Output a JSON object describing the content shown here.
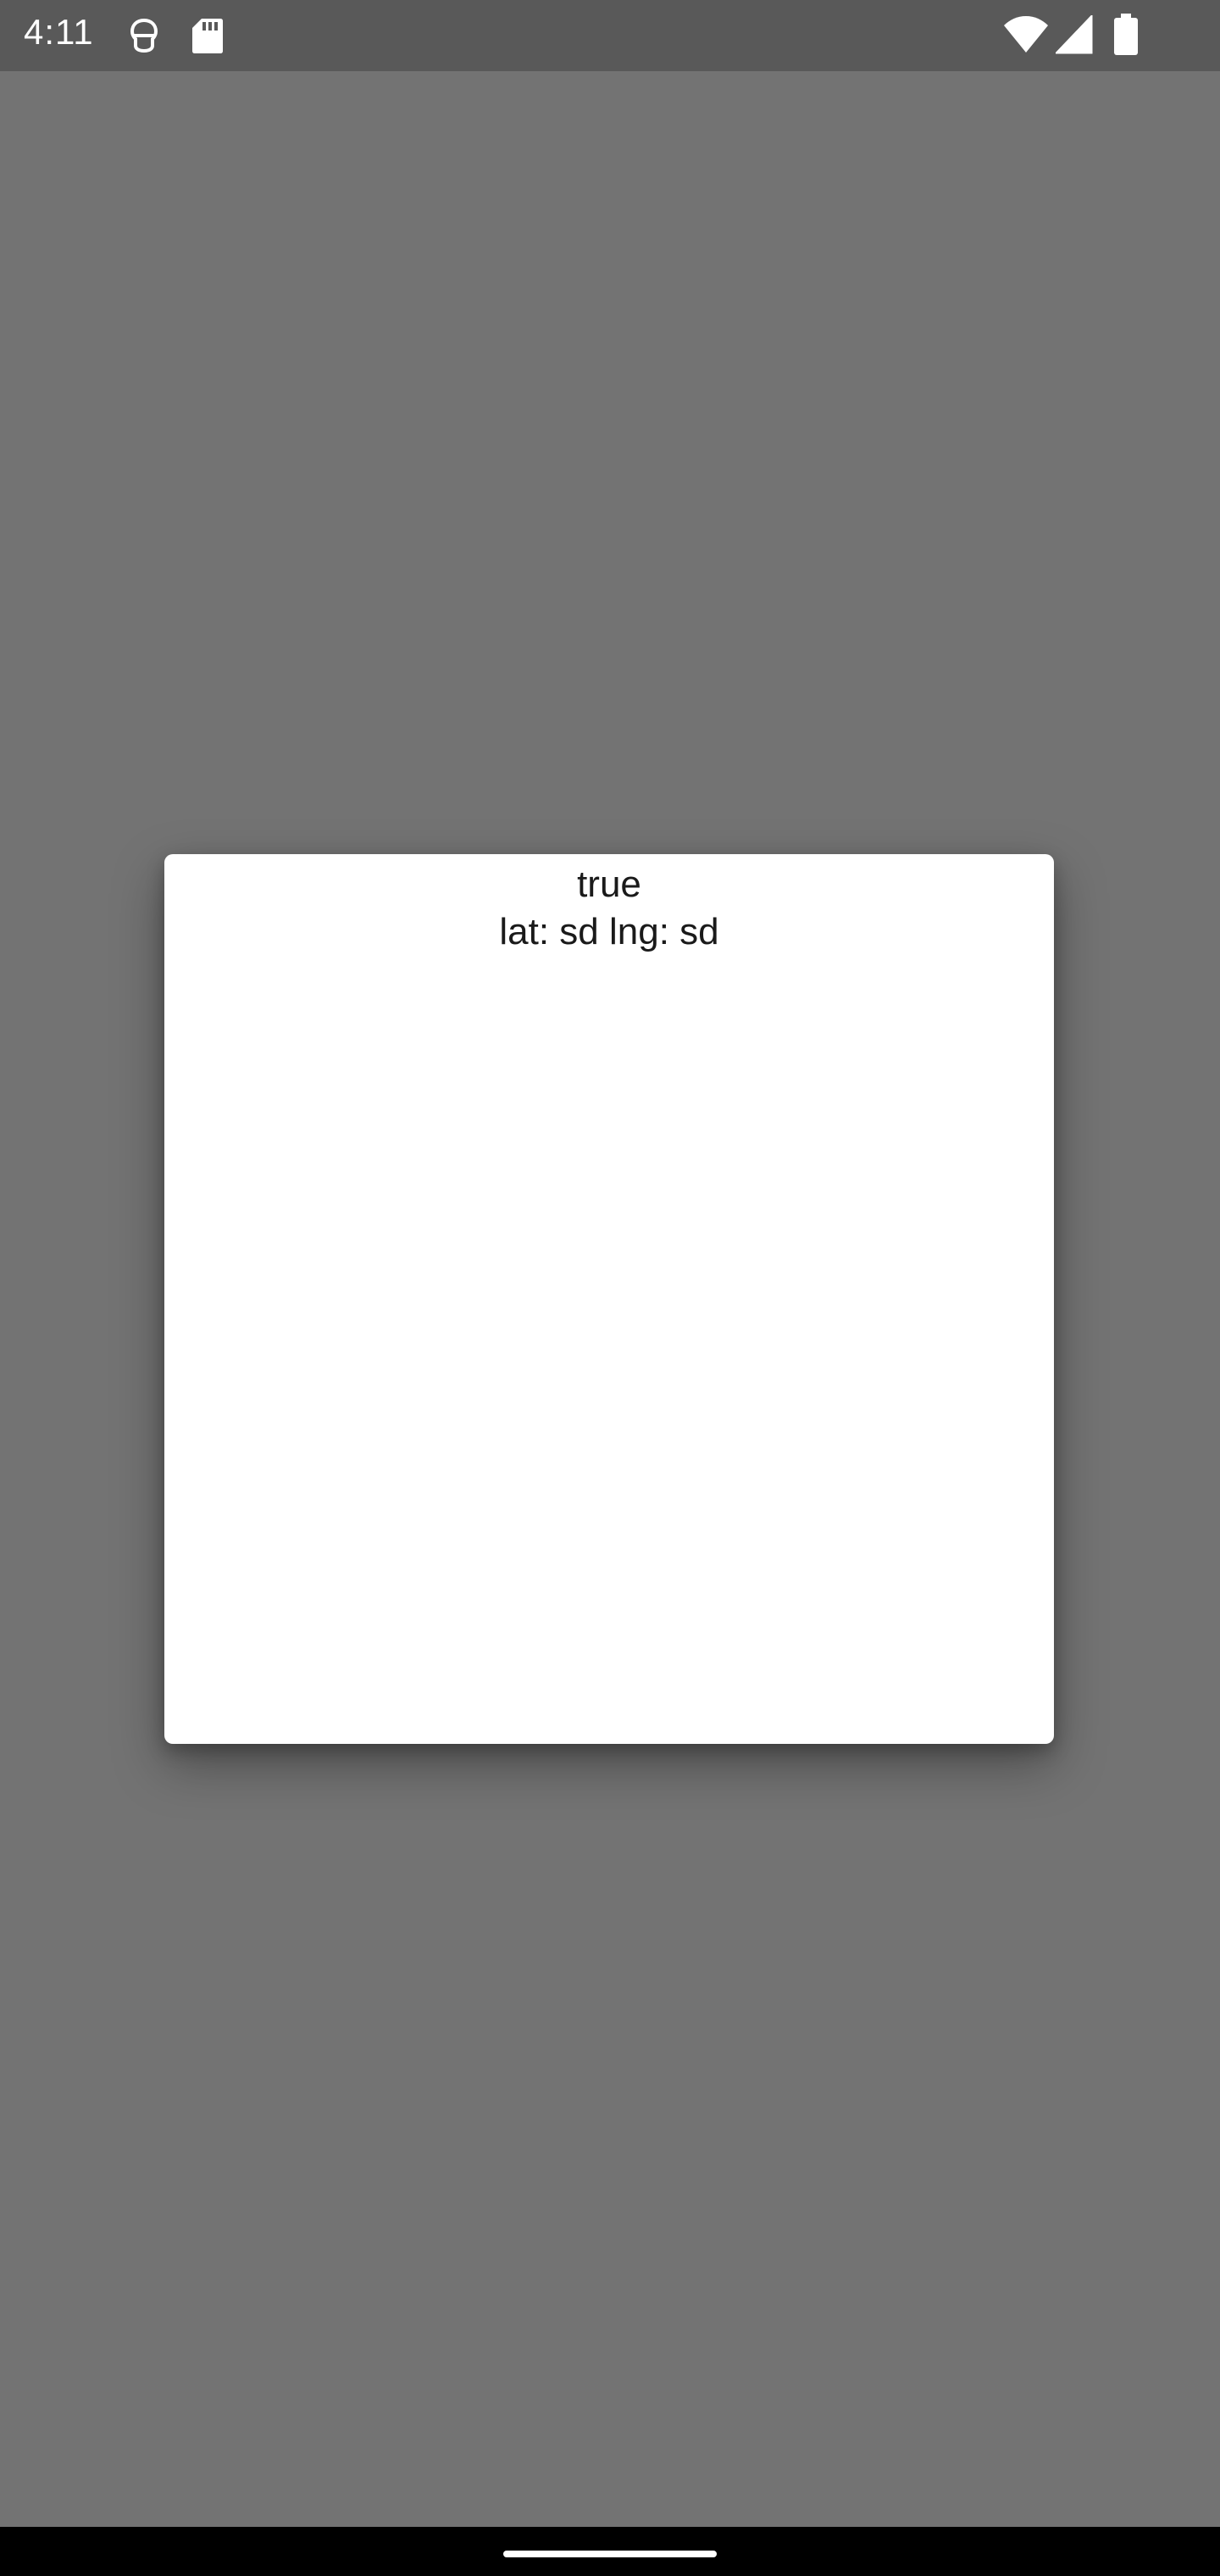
{
  "status_bar": {
    "time": "4:11",
    "icons": [
      "location-icon",
      "sd-card-icon",
      "wifi-icon",
      "signal-icon",
      "battery-icon"
    ]
  },
  "dialog": {
    "line1": "true",
    "line2": "lat: sd lng: sd"
  },
  "colors": {
    "scrim": "#737373",
    "status_bar": "#595959",
    "dialog_bg": "#ffffff",
    "nav_bar": "#000000"
  }
}
